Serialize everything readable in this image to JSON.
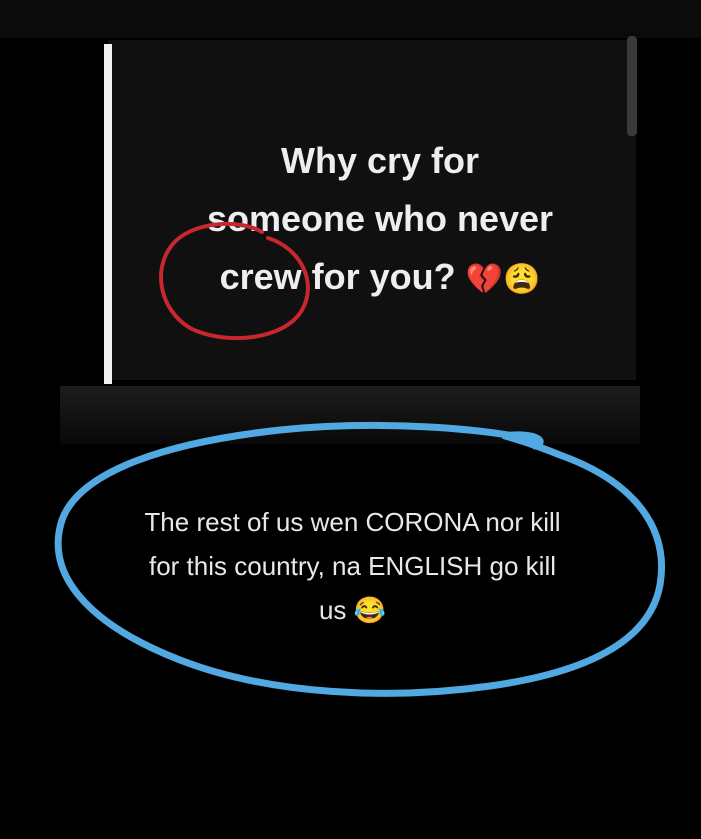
{
  "post": {
    "line1": "Why cry for",
    "line2": "someone who never",
    "line3": "crew for you?",
    "emojis": "💔😩"
  },
  "comment": {
    "line1": "The rest of us wen CORONA nor kill",
    "line2": "for this country, na ENGLISH go kill",
    "line3": "us",
    "emoji": "😂"
  },
  "colors": {
    "red_circle": "#c7272e",
    "blue_circle": "#52a8e0"
  }
}
